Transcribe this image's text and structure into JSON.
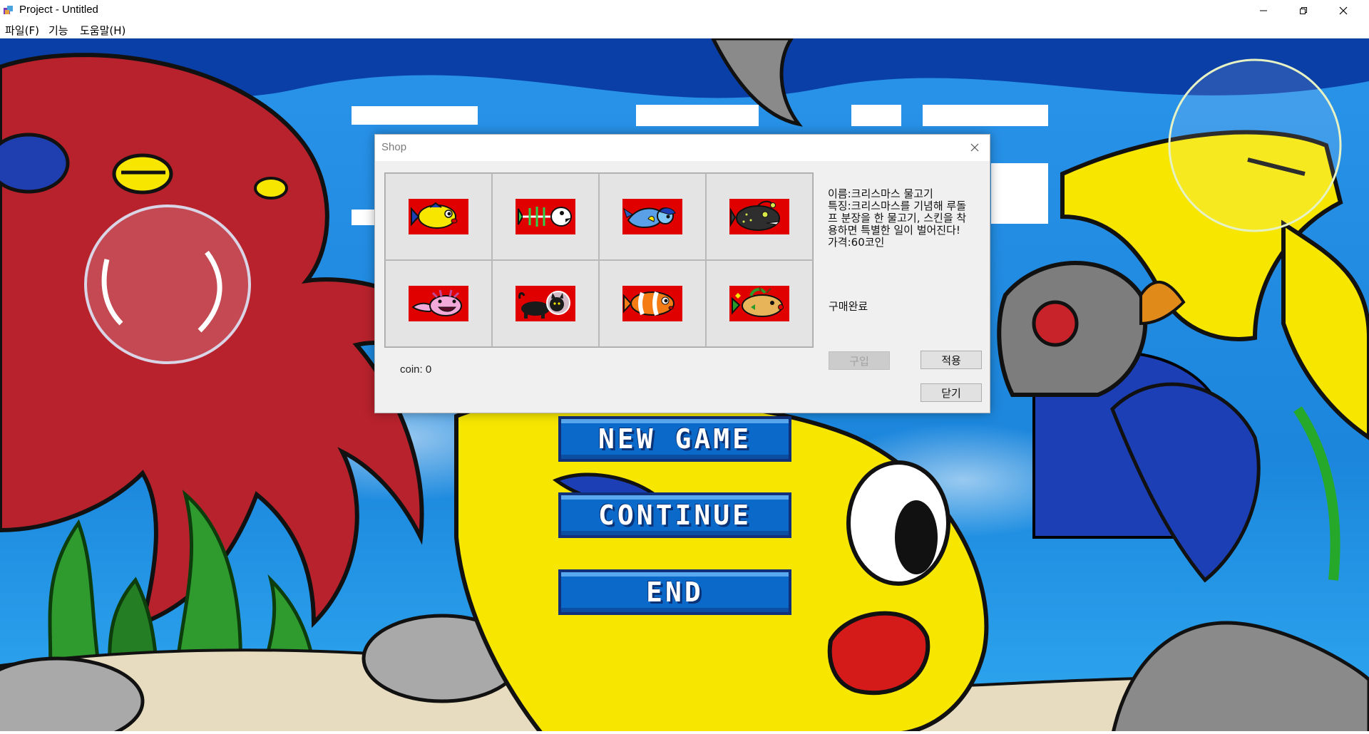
{
  "window": {
    "title": "Project - Untitled",
    "icons": [
      "app-icon",
      "minimize-icon",
      "restore-icon",
      "close-icon"
    ]
  },
  "menubar": {
    "items": [
      "파일(F)",
      "기능",
      "도움말(H)"
    ]
  },
  "game": {
    "buttons": [
      "NEW GAME",
      "CONTINUE",
      "END"
    ]
  },
  "shop": {
    "title": "Shop",
    "items": [
      "yellow-fish-skin-icon",
      "skeleton-fish-skin-icon",
      "blue-mermaid-skin-icon",
      "angler-fish-skin-icon",
      "pink-axolotl-skin-icon",
      "black-cat-skin-icon",
      "clownfish-skin-icon",
      "christmas-fish-skin-icon"
    ],
    "coin_label": "coin: 0",
    "info_lines": [
      "이름:크리스마스 물고기",
      "특징:크리스마스를 기념해 루돌프 분장을 한 물고기, 스킨을 착용하면 특별한 일이 벌어진다!",
      "가격:60코인"
    ],
    "status": "구매완료",
    "buy_label": "구입",
    "apply_label": "적용",
    "close_label": "닫기"
  },
  "colors": {
    "item_bg": "#e10000",
    "button_blue": "#0b69c9",
    "ocean": "#1f8ee6",
    "octopus": "#b8222c",
    "yellow_fish": "#f6e600"
  }
}
